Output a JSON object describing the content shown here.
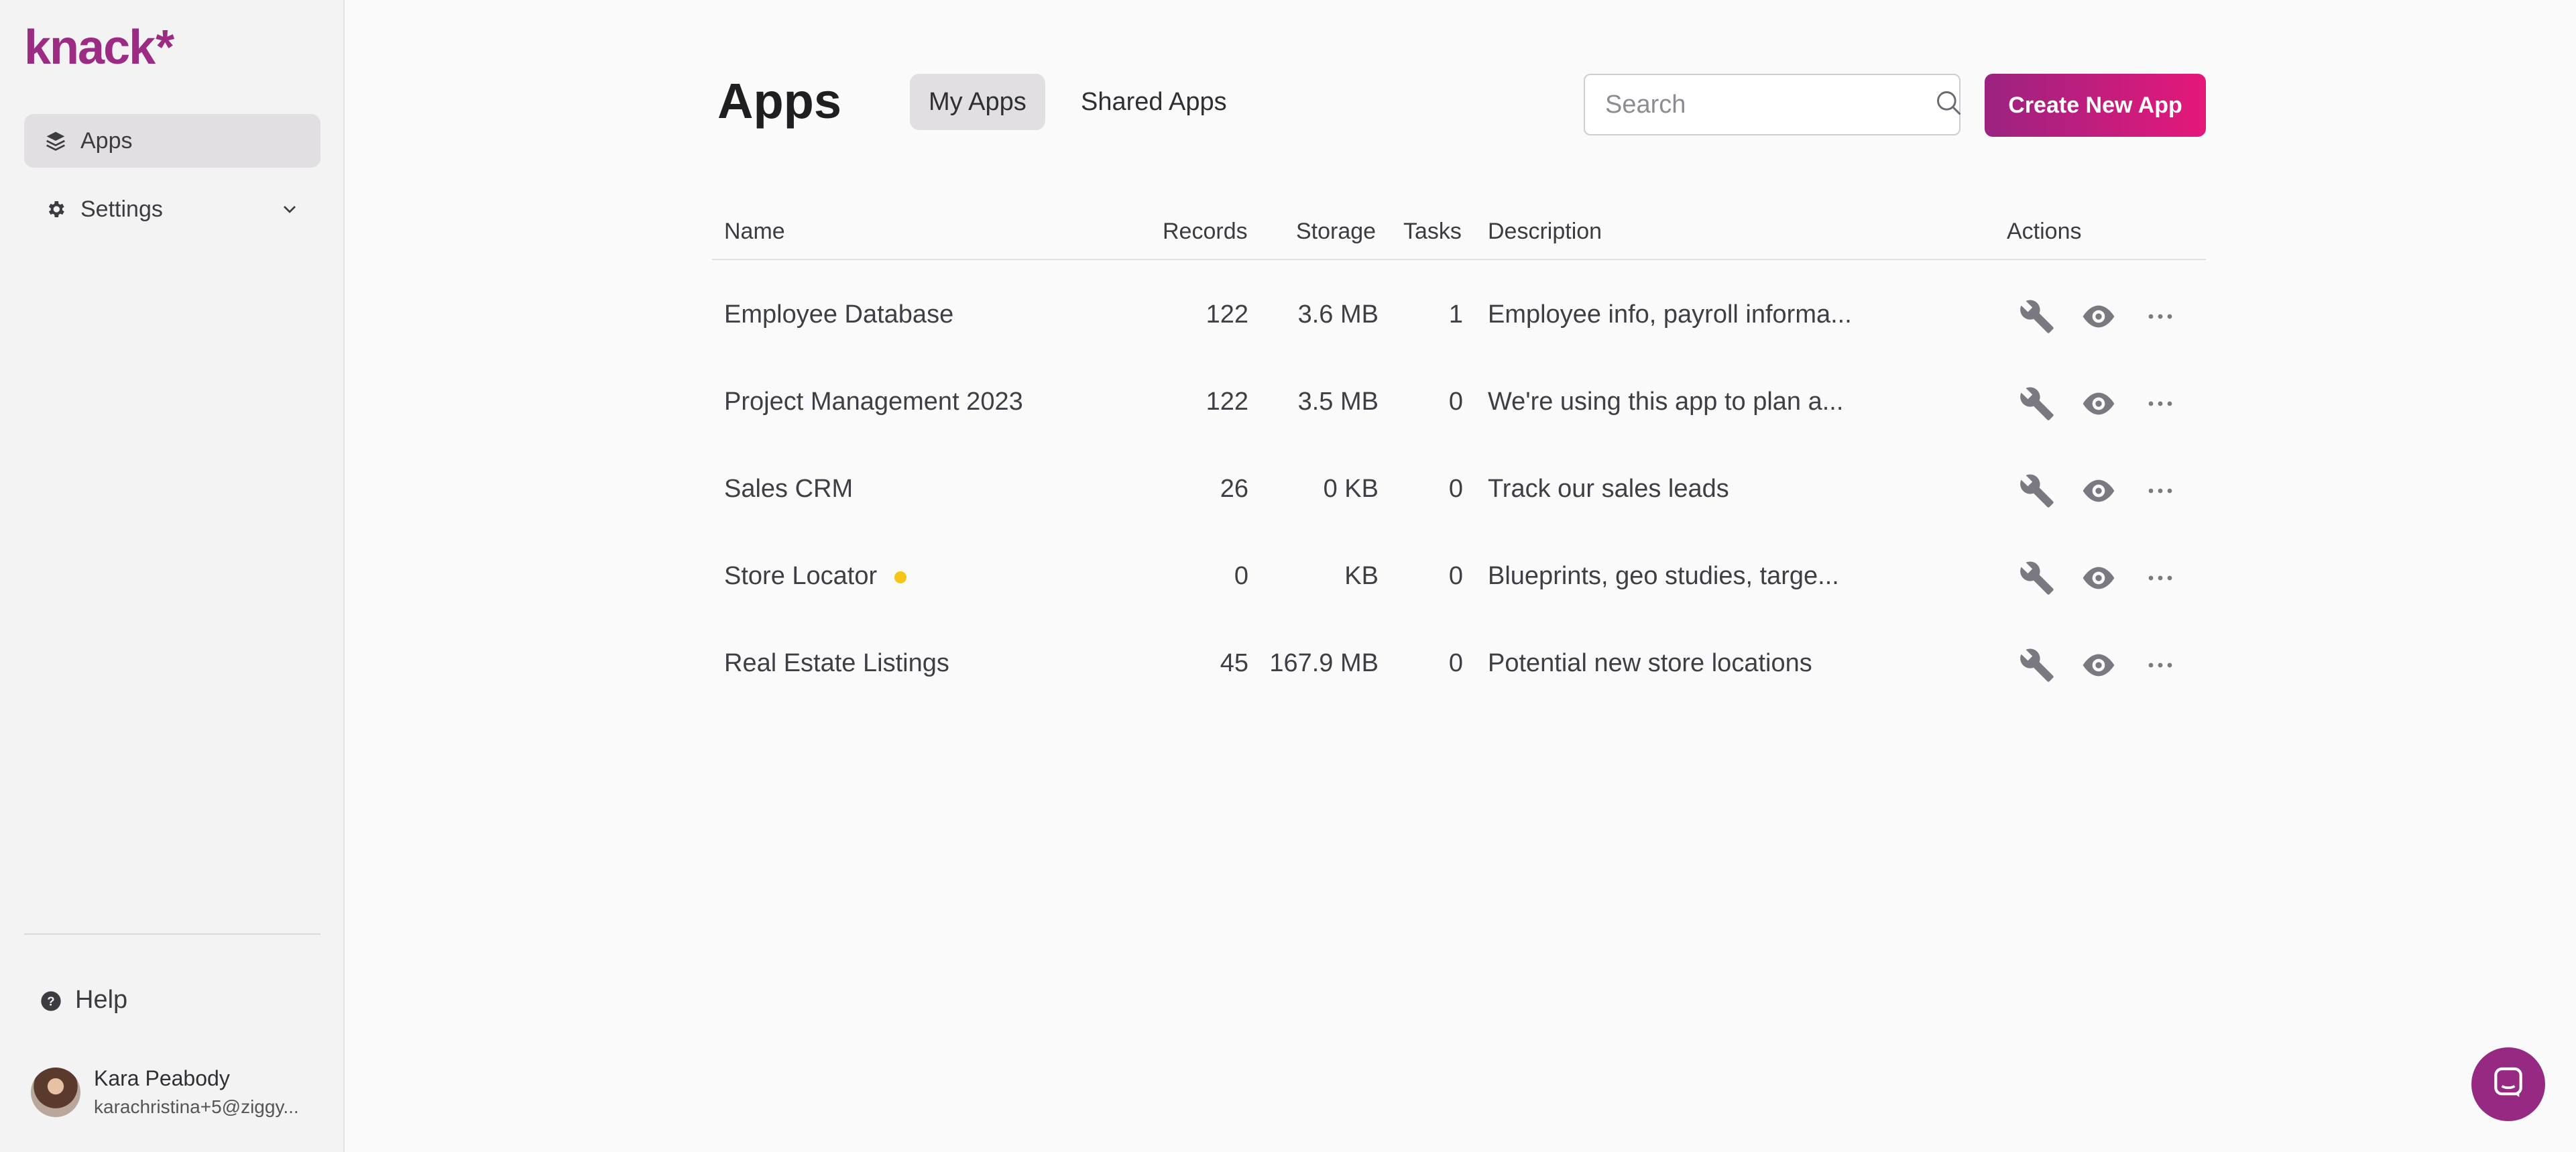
{
  "sidebar": {
    "logo": "knack",
    "logo_mark": "*",
    "items": [
      {
        "label": "Apps",
        "icon": "layers-icon"
      },
      {
        "label": "Settings",
        "icon": "gear-icon"
      }
    ],
    "help_label": "Help",
    "user": {
      "name": "Kara Peabody",
      "email": "karachristina+5@ziggy..."
    }
  },
  "header": {
    "title": "Apps",
    "tabs": [
      {
        "label": "My Apps",
        "active": true
      },
      {
        "label": "Shared Apps",
        "active": false
      }
    ],
    "search_placeholder": "Search",
    "create_label": "Create New App"
  },
  "table": {
    "columns": [
      "Name",
      "Records",
      "Storage",
      "Tasks",
      "Description",
      "Actions"
    ],
    "rows": [
      {
        "name": "Employee Database",
        "records": "122",
        "storage": "3.6 MB",
        "tasks": "1",
        "description": "Employee info, payroll informa..."
      },
      {
        "name": "Project Management 2023",
        "records": "122",
        "storage": "3.5 MB",
        "tasks": "0",
        "description": "We're using this app to plan a..."
      },
      {
        "name": "Sales CRM",
        "records": "26",
        "storage": "0 KB",
        "tasks": "0",
        "description": "Track our sales leads"
      },
      {
        "name": "Store Locator",
        "records": "0",
        "storage": "KB",
        "tasks": "0",
        "description": "Blueprints, geo studies, targe...",
        "status_dot": true
      },
      {
        "name": "Real Estate Listings",
        "records": "45",
        "storage": "167.9 MB",
        "tasks": "0",
        "description": "Potential new store locations"
      }
    ]
  },
  "colors": {
    "brand": "#9b2b83",
    "button_gradient_start": "#9b2380",
    "button_gradient_end": "#e5187a",
    "status_dot": "#f5c518"
  }
}
